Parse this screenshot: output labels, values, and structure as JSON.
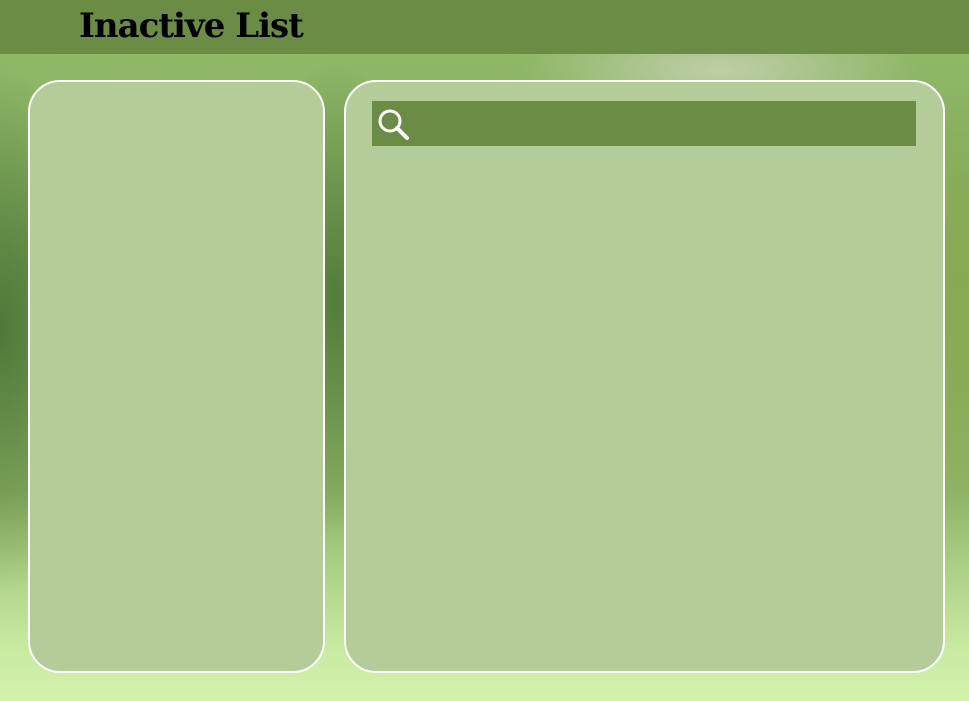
{
  "header": {
    "title": "Inactive List"
  },
  "search": {
    "value": "",
    "placeholder": "",
    "icon": "search-icon"
  },
  "colors": {
    "header_bg": "#6a8c45",
    "panel_bg": "#b4cd98",
    "panel_border": "#ffffff",
    "search_bg": "#6a8c45"
  }
}
